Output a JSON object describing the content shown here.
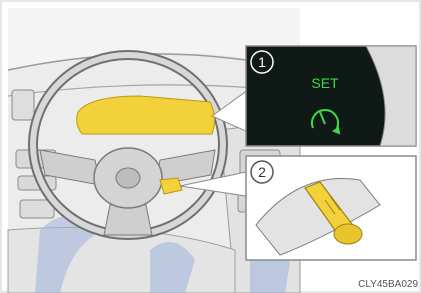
{
  "callouts": [
    {
      "number": "1",
      "indicator_text": "SET",
      "icon": "cruise-control-icon",
      "panel_color": "#0f1a16",
      "indicator_color": "#3fd84a"
    },
    {
      "number": "2",
      "icon": "cruise-control-lever",
      "panel_color": "#ffffff"
    }
  ],
  "colors": {
    "highlight": "#f2d13a",
    "line_art": "#7f7f7f",
    "interior_fill": "#e6e6e6",
    "accent_blue": "#9fb3dc"
  },
  "image_code": "CLY45BA029"
}
